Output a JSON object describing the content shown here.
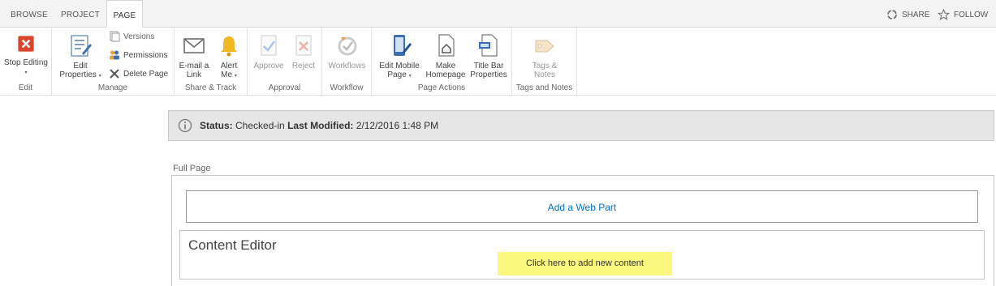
{
  "tabs": [
    {
      "label": "BROWSE",
      "active": false
    },
    {
      "label": "PROJECT",
      "active": false
    },
    {
      "label": "PAGE",
      "active": true
    }
  ],
  "header_actions": {
    "share": "SHARE",
    "follow": "FOLLOW"
  },
  "ribbon": {
    "edit": {
      "label": "Edit",
      "stop_editing_label": "Stop Editing",
      "stop_editing_caret": "▾"
    },
    "manage": {
      "label": "Manage",
      "edit_properties_line1": "Edit",
      "edit_properties_line2": "Properties",
      "versions": "Versions",
      "permissions": "Permissions",
      "delete_page": "Delete Page"
    },
    "share_track": {
      "label": "Share & Track",
      "email_line1": "E-mail a",
      "email_line2": "Link",
      "alert_line1": "Alert",
      "alert_line2": "Me"
    },
    "approval": {
      "label": "Approval",
      "approve": "Approve",
      "reject": "Reject"
    },
    "workflow": {
      "label": "Workflow",
      "workflows": "Workflows"
    },
    "page_actions": {
      "label": "Page Actions",
      "mobile_line1": "Edit Mobile",
      "mobile_line2": "Page",
      "homepage_line1": "Make",
      "homepage_line2": "Homepage",
      "titlebar_line1": "Title Bar",
      "titlebar_line2": "Properties"
    },
    "tags_notes": {
      "label": "Tags and Notes",
      "tags_line1": "Tags &",
      "tags_line2": "Notes"
    }
  },
  "status_bar": {
    "status_label": "Status:",
    "status_value": "Checked-in",
    "modified_label": "Last Modified:",
    "modified_value": "2/12/2016 1:48 PM"
  },
  "content": {
    "zone_label": "Full Page",
    "add_web_part": "Add a Web Part",
    "content_editor_title": "Content Editor",
    "add_content": "Click here to add new content"
  },
  "colors": {
    "accent": "#0072c6",
    "highlight": "#fbf77f",
    "stop_red": "#d9442c"
  }
}
